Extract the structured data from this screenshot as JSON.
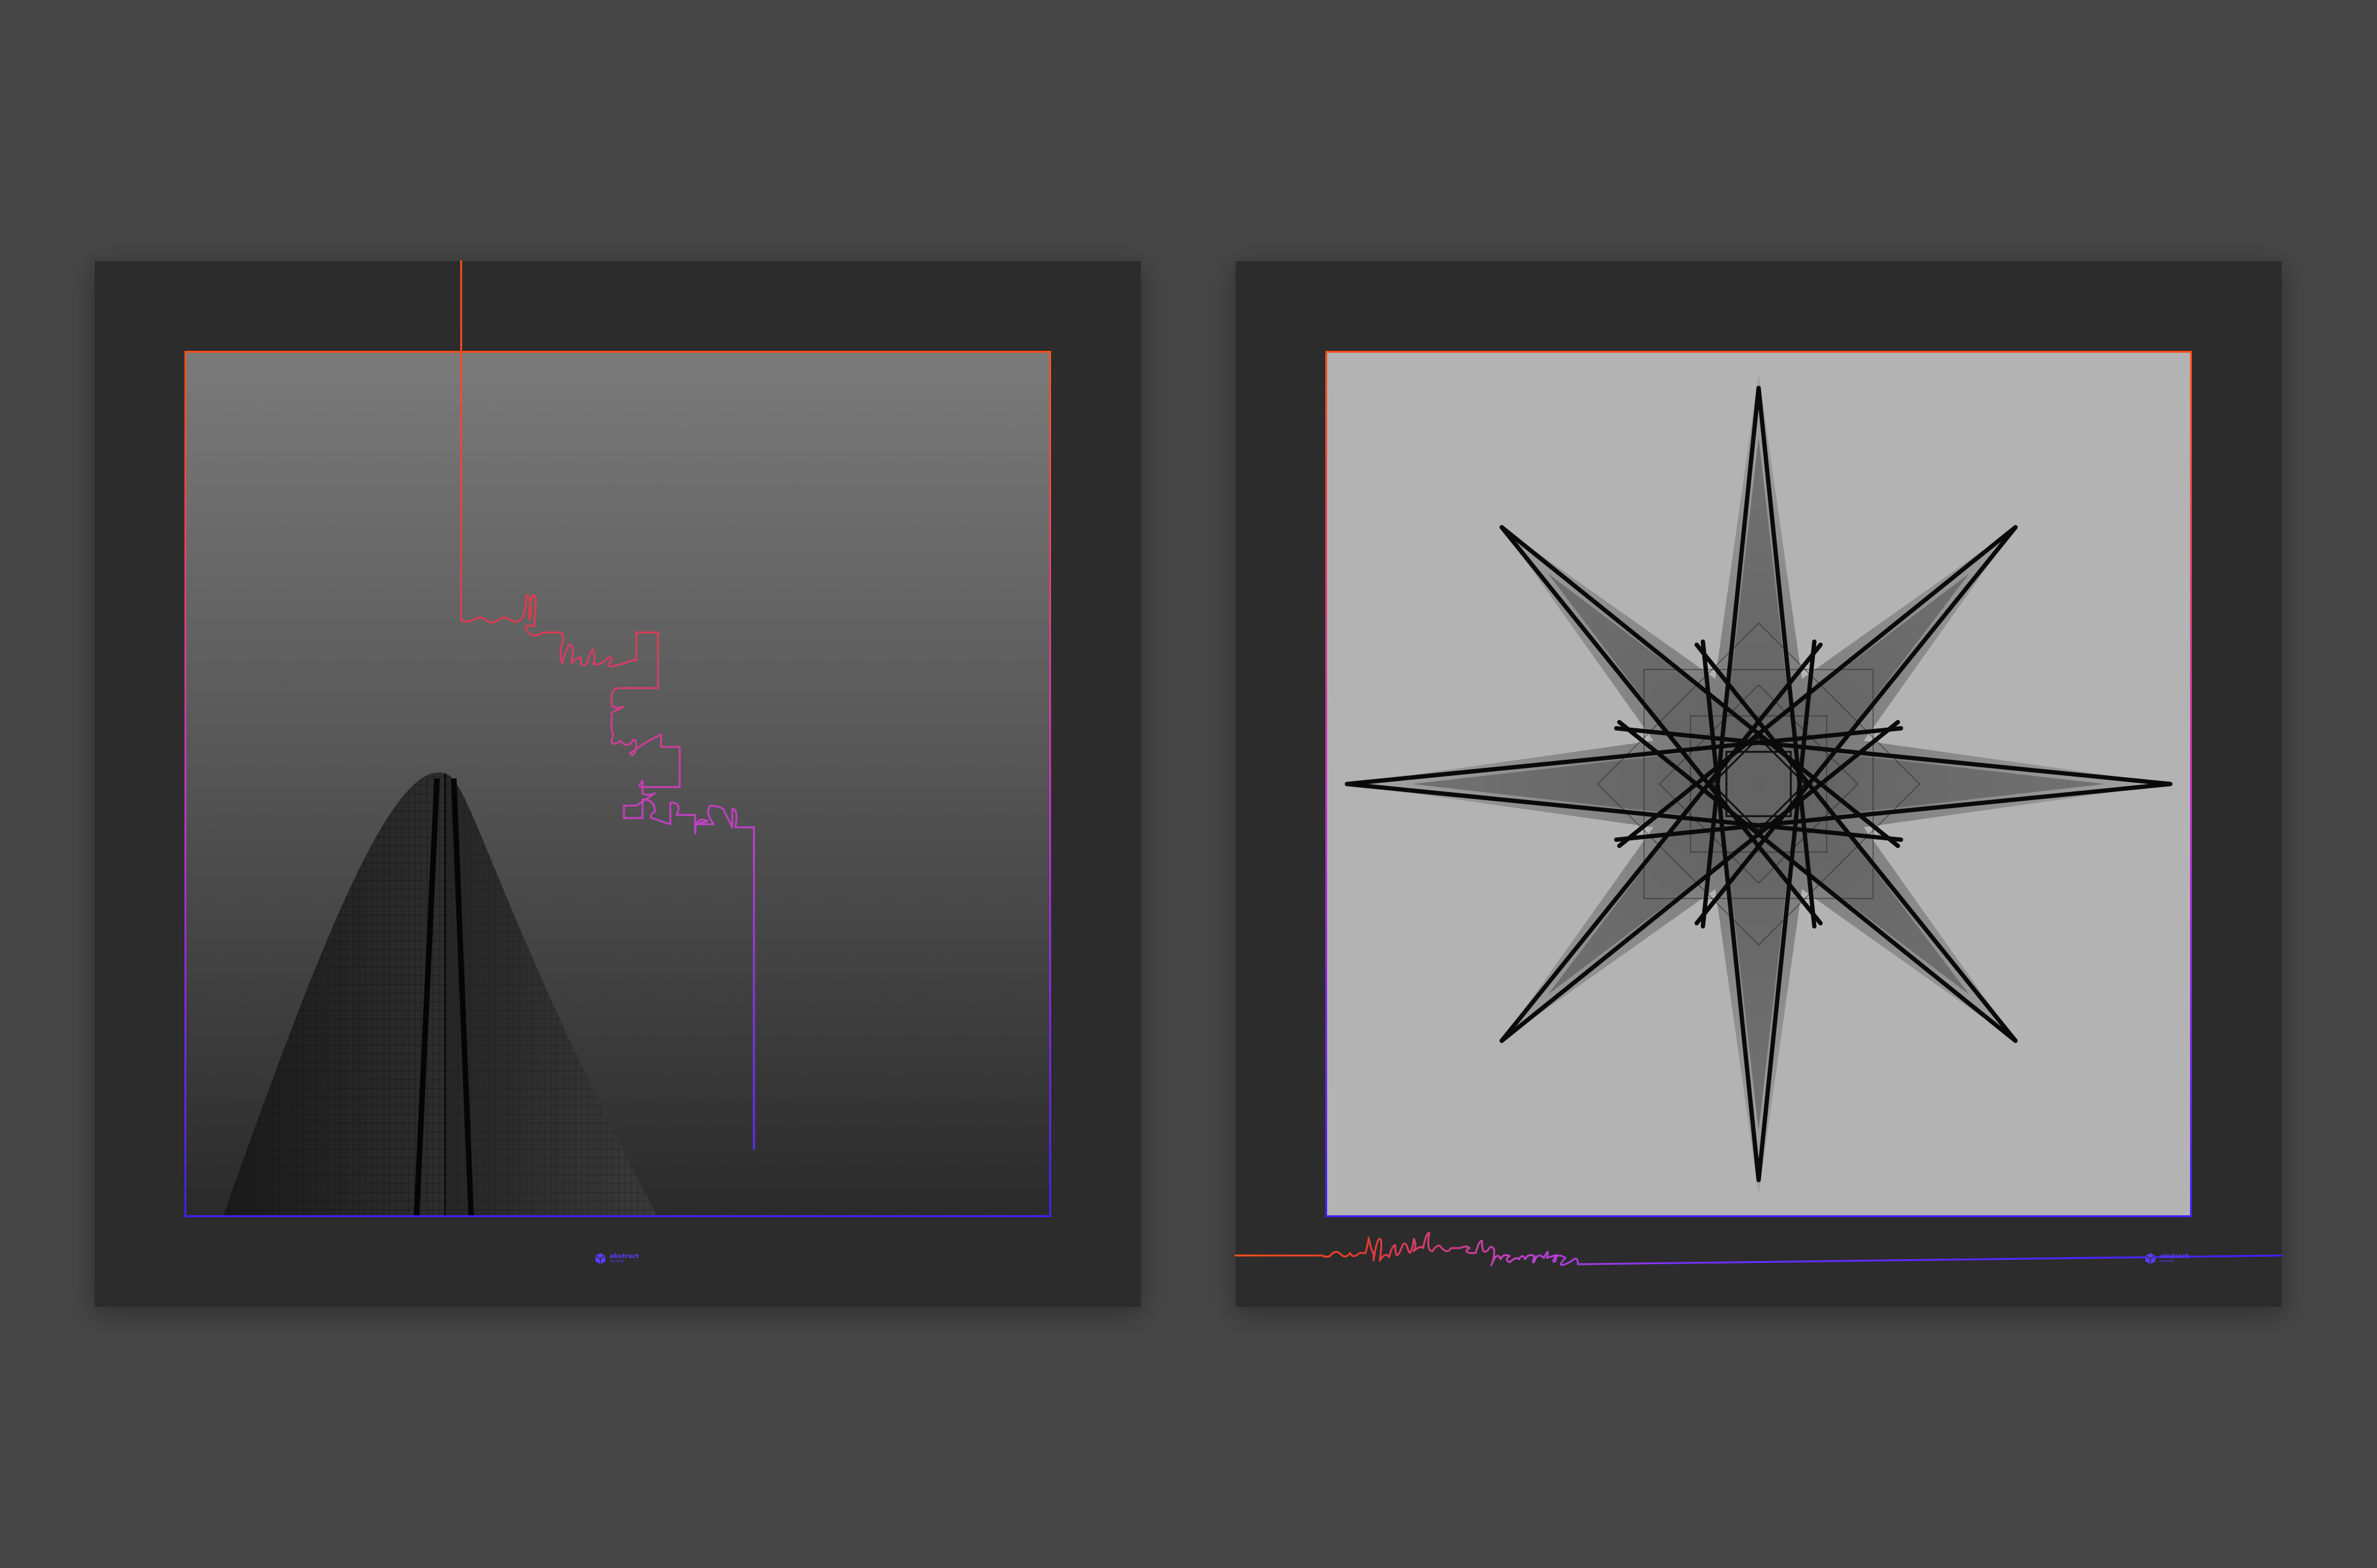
{
  "mockup": {
    "background_color": "#464646",
    "sleeve_color": "#2c2c2c",
    "gradient_colors": [
      "#ff5018",
      "#c030d0",
      "#4020ff"
    ]
  },
  "sleeve_front": {
    "title_script": "my little skyscraper",
    "photo": "skyscraper-photo"
  },
  "sleeve_back": {
    "title_script": "my little skyscraper",
    "artwork": "kaleidoscope-star"
  },
  "brand": {
    "name": "abstract",
    "subline": "records",
    "icon": "hexagon-cube-icon"
  }
}
